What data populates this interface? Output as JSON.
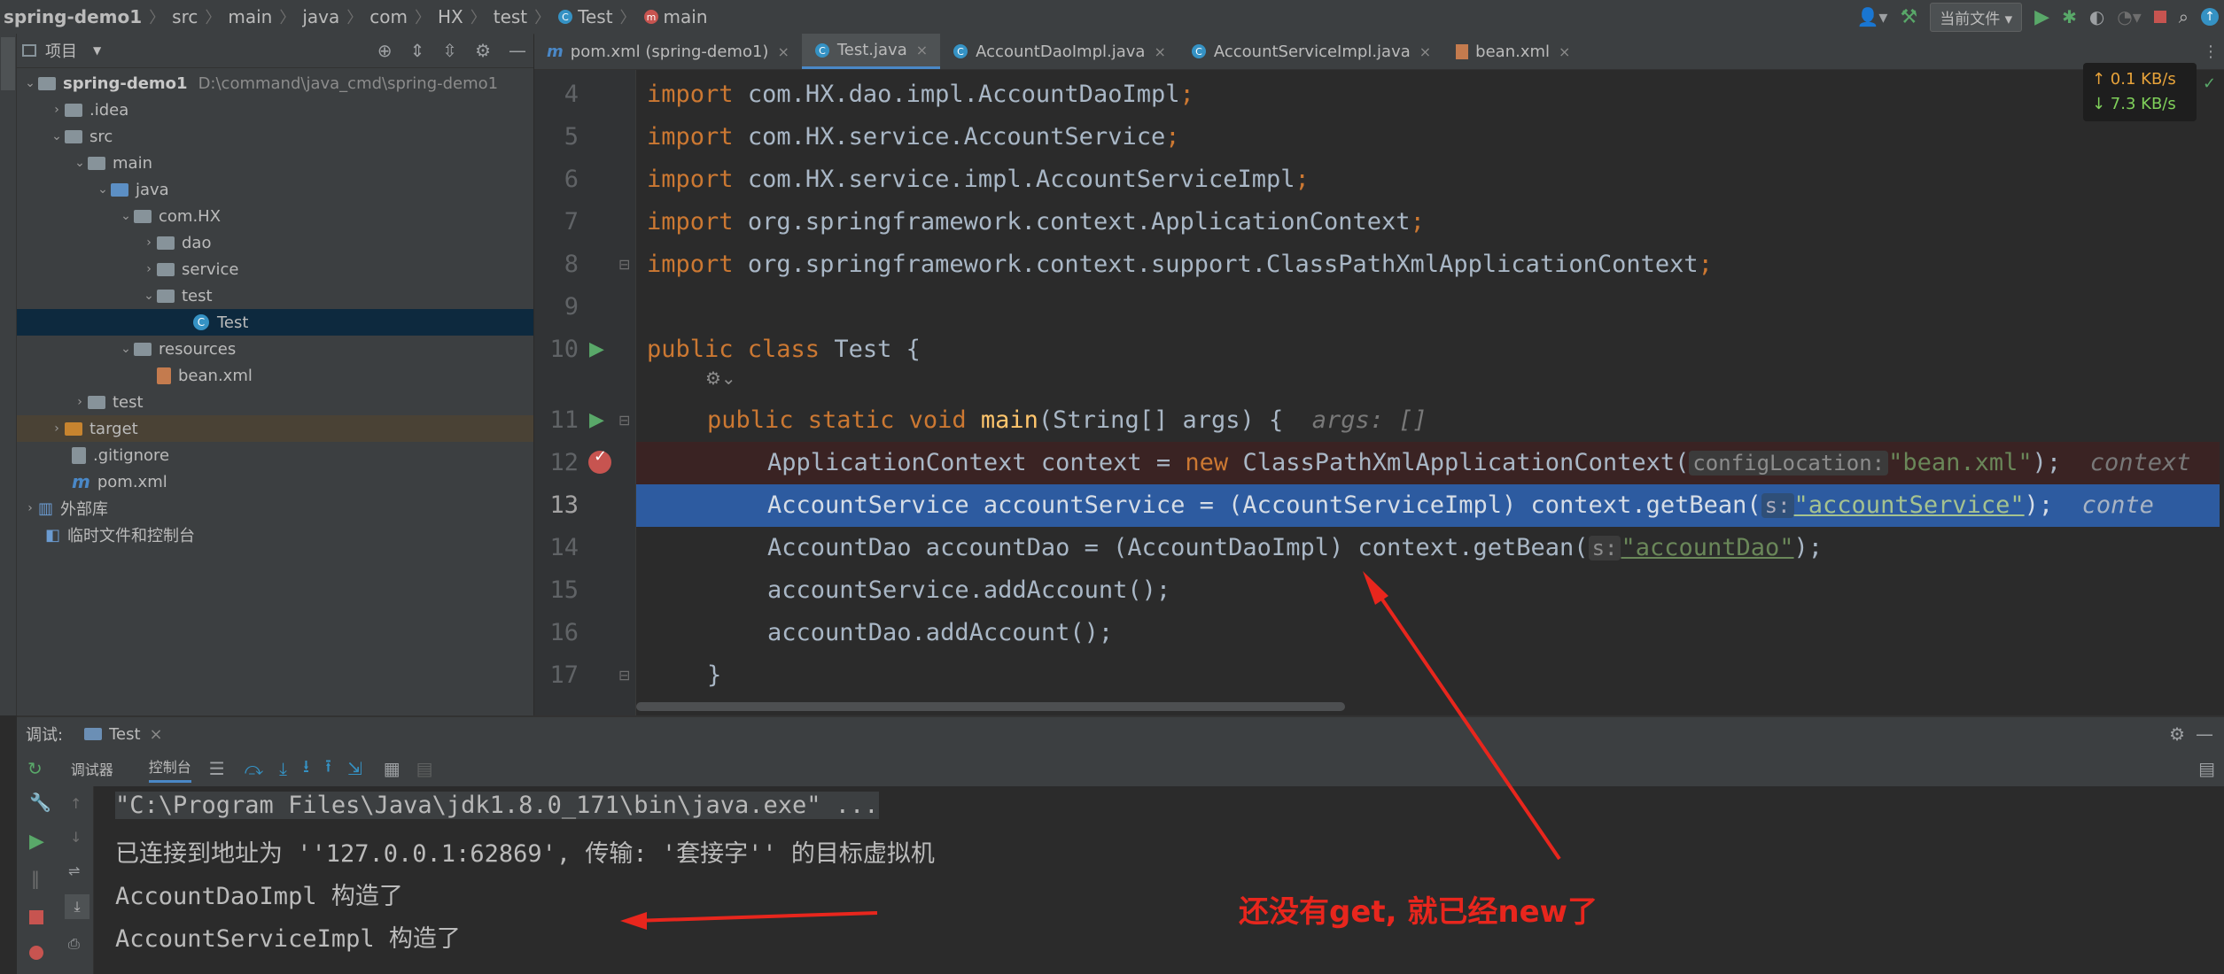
{
  "breadcrumb": [
    "spring-demo1",
    "src",
    "main",
    "java",
    "com",
    "HX",
    "test",
    "Test",
    "main"
  ],
  "toolbar": {
    "run_config": "当前文件"
  },
  "project": {
    "header_label": "项目",
    "root_name": "spring-demo1",
    "root_path": "D:\\command\\java_cmd\\spring-demo1",
    "tree": [
      {
        "label": ".idea",
        "kind": "folder"
      },
      {
        "label": "src",
        "kind": "folder"
      },
      {
        "label": "main",
        "kind": "folder"
      },
      {
        "label": "java",
        "kind": "folder-blue"
      },
      {
        "label": "com.HX",
        "kind": "folder"
      },
      {
        "label": "dao",
        "kind": "folder"
      },
      {
        "label": "service",
        "kind": "folder"
      },
      {
        "label": "test",
        "kind": "folder"
      },
      {
        "label": "Test",
        "kind": "class"
      },
      {
        "label": "resources",
        "kind": "folder"
      },
      {
        "label": "bean.xml",
        "kind": "xml"
      },
      {
        "label": "test",
        "kind": "folder"
      },
      {
        "label": "target",
        "kind": "folder-orange"
      },
      {
        "label": ".gitignore",
        "kind": "file"
      },
      {
        "label": "pom.xml",
        "kind": "maven"
      },
      {
        "label": "外部库",
        "kind": "lib"
      },
      {
        "label": "临时文件和控制台",
        "kind": "scratch"
      }
    ]
  },
  "tabs": [
    {
      "label": "pom.xml (spring-demo1)",
      "active": false
    },
    {
      "label": "Test.java",
      "active": true
    },
    {
      "label": "AccountDaoImpl.java",
      "active": false
    },
    {
      "label": "AccountServiceImpl.java",
      "active": false
    },
    {
      "label": "bean.xml",
      "active": false
    }
  ],
  "editor": {
    "lines": [
      "4",
      "5",
      "6",
      "7",
      "8",
      "9",
      "10",
      "11",
      "12",
      "13",
      "14",
      "15",
      "16",
      "17"
    ],
    "imports": [
      "com.HX.dao.impl.AccountDaoImpl",
      "com.HX.service.AccountService",
      "com.HX.service.impl.AccountServiceImpl",
      "org.springframework.context.ApplicationContext",
      "org.springframework.context.support.ClassPathXmlApplicationContext"
    ],
    "kw_import": "import",
    "class_decl": {
      "kw": "public class",
      "name": " Test {"
    },
    "main_decl": {
      "kw": "public static void",
      "name": "main",
      "params": "(String[] args) {",
      "hint": "args: []"
    },
    "l12": {
      "pre": "ApplicationContext context = ",
      "kw": "new",
      "post": " ClassPathXmlApplicationContext(",
      "param": "configLocation:",
      "str": "\"bean.xml\"",
      "end": ");",
      "hint": "context"
    },
    "l13": {
      "pre": "AccountService accountService = (AccountServiceImpl) context.getBean(",
      "param": "s:",
      "str": "\"accountService\"",
      "end": ");",
      "hint": "conte"
    },
    "l14": {
      "pre": "AccountDao accountDao = (AccountDaoImpl) context.getBean(",
      "param": "s:",
      "str": "\"accountDao\"",
      "end": ");"
    },
    "l15": "accountService.addAccount();",
    "l16": "accountDao.addAccount();",
    "l17": "}"
  },
  "net": {
    "up": "↑ 0.1 KB/s",
    "down": "↓ 7.3 KB/s"
  },
  "debug": {
    "label": "调试:",
    "session": "Test",
    "tab_debugger": "调试器",
    "tab_console": "控制台"
  },
  "console": {
    "lines": [
      "\"C:\\Program Files\\Java\\jdk1.8.0_171\\bin\\java.exe\" ...",
      "已连接到地址为 ''127.0.0.1:62869', 传输: '套接字'' 的目标虚拟机",
      "AccountDaoImpl 构造了",
      "AccountServiceImpl 构造了"
    ]
  },
  "annotation": "还没有get, 就已经new了"
}
